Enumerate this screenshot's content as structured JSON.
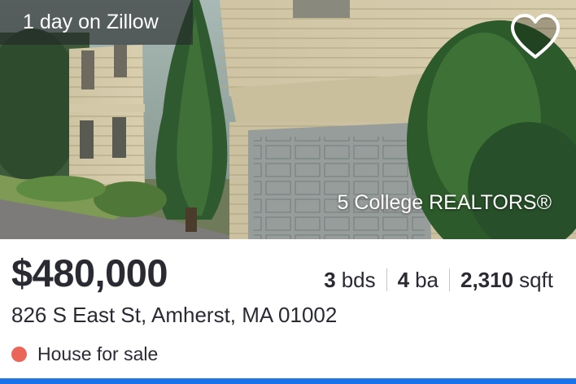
{
  "listing": {
    "time_on_site": "1 day on Zillow",
    "brokerage": "5 College REALTORS®",
    "price": "$480,000",
    "beds_value": "3",
    "beds_unit": "bds",
    "baths_value": "4",
    "baths_unit": "ba",
    "sqft_value": "2,310",
    "sqft_unit": "sqft",
    "address": "826 S East St, Amherst, MA 01002",
    "status": "House for sale"
  },
  "colors": {
    "status_dot": "#ec6559",
    "accent_bar": "#1a73e8",
    "text": "#2a2a33"
  },
  "icons": {
    "favorite": "heart-outline-icon",
    "status": "status-dot-icon"
  }
}
